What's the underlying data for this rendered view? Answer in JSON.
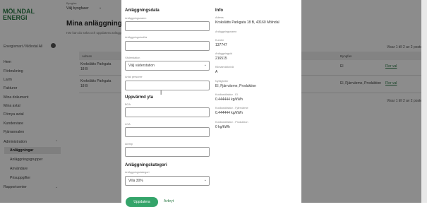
{
  "app": {
    "logo_line1": "MÖLNDAL",
    "logo_line2": "ENERGI",
    "user": "Energismart / Mölndal All",
    "nav": [
      {
        "label": "Hem"
      },
      {
        "label": "Förbrukning"
      },
      {
        "label": "Larm"
      },
      {
        "label": "Fakturor"
      },
      {
        "label": "Mina dokument"
      },
      {
        "label": "Mina avtal"
      },
      {
        "label": "Förnya avtal"
      },
      {
        "label": "Kunderviare"
      },
      {
        "label": "Fjärrannalen"
      },
      {
        "label": "Administration"
      },
      {
        "label": "Anläggningar"
      },
      {
        "label": "Anläggningsgrupper"
      },
      {
        "label": "Användare"
      },
      {
        "label": "Prisuppgifter"
      },
      {
        "label": "Rapportcenter"
      }
    ],
    "filter_label": "Byngfas",
    "filter_value": "Välj byngfaser",
    "page_title": "Mina anläggningar",
    "page_desc": "Här kan du söka och uppdatera anläggningsuppgifter",
    "count_top": "Visar 1 till 2 av 2 poster",
    "count_bottom": "Visar 1 till 2 av 2 poster",
    "columns": [
      "Adress",
      "Byngfas"
    ],
    "rows": [
      {
        "addr1": "Krokslätts Parkgata",
        "addr2": "18 B",
        "type": "El",
        "link": "Fler val"
      },
      {
        "addr1": "Krokslätts Parkgata",
        "addr2": "18 B",
        "type": "El, Fjärrvärme, Produktion",
        "link": "Fler val"
      }
    ]
  },
  "modal": {
    "section1": "Anläggningsdata",
    "f_name_label": "Anläggningsnamn",
    "f_code_label": "Anläggningskod/ta",
    "f_station_label": "Väderstation",
    "f_station_value": "Välj väderstation",
    "f_persons_label": "Antal personer",
    "section2": "Uppvärmd yta",
    "f_boa_label": "BOA",
    "f_loa_label": "LOA",
    "f_atemp_label": "Atemp",
    "section3": "Anläggningskategori",
    "f_cat_label": "Anläggningskategori",
    "f_cat_value": "Villa 30%",
    "save": "Uppdatera",
    "cancel": "Avbryt",
    "info": {
      "title": "Info",
      "items": [
        {
          "k": "Adress",
          "v": "Krokslätts Parkgata 18 B, 43160 Mölndal"
        },
        {
          "k": "Anläggningsnamn",
          "v": ""
        },
        {
          "k": "Kundnr",
          "v": "137747"
        },
        {
          "k": "Anläggningsid",
          "v": "216515"
        },
        {
          "k": "Klimatmärknivå",
          "v": "A"
        },
        {
          "k": "Nyttigheter",
          "v": "El, Fjärrvärme, Produktion"
        },
        {
          "k": "Koldioxidfaktor - El",
          "v": "0.444444 kg/kWh"
        },
        {
          "k": "Koldioxidfaktor - Fjärrvärme",
          "v": "0.444444 kg/kWh"
        },
        {
          "k": "Koldioxidfaktor - Produktion",
          "v": "0 kg/kWh"
        }
      ]
    }
  }
}
